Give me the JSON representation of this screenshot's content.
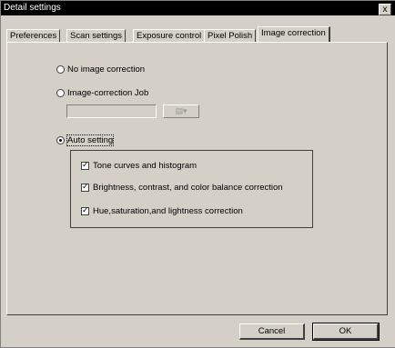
{
  "window": {
    "title": "Detail settings",
    "close_glyph": "x"
  },
  "tabs": [
    {
      "label": "Preferences"
    },
    {
      "label": "Scan settings"
    },
    {
      "label": "Exposure control"
    },
    {
      "label": "Pixel Polish"
    },
    {
      "label": "Image correction",
      "active": true
    }
  ],
  "options": {
    "no_correction": {
      "label": "No image correction",
      "selected": false
    },
    "job": {
      "label": "Image-correction Job",
      "selected": false,
      "value": "",
      "button_glyph": "▤▾"
    },
    "auto": {
      "label": "Auto setting",
      "selected": true
    }
  },
  "auto_settings": [
    {
      "label": "Tone curves and histogram",
      "checked": true
    },
    {
      "label": "Brightness, contrast, and color balance correction",
      "checked": true
    },
    {
      "label": "Hue,saturation,and lightness correction",
      "checked": true
    }
  ],
  "buttons": {
    "cancel": "Cancel",
    "ok": "OK"
  }
}
